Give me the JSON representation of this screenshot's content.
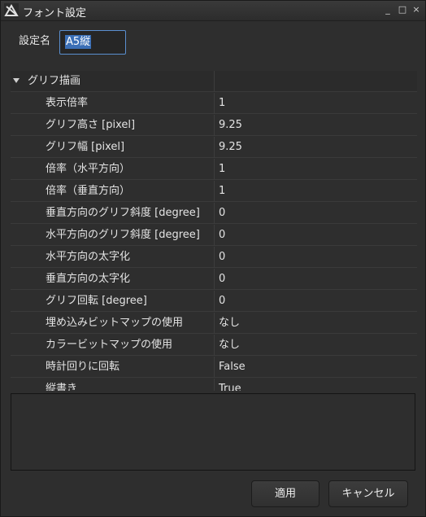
{
  "window": {
    "title": "フォント設定",
    "minimize": "_",
    "maximize": "□",
    "close": "×"
  },
  "name_field": {
    "label": "設定名",
    "value": "A5縦"
  },
  "group": {
    "label": "グリフ描画",
    "expanded": true
  },
  "properties": [
    {
      "key": "表示倍率",
      "value": "1"
    },
    {
      "key": "グリフ高さ [pixel]",
      "value": "9.25"
    },
    {
      "key": "グリフ幅 [pixel]",
      "value": "9.25"
    },
    {
      "key": "倍率（水平方向）",
      "value": "1"
    },
    {
      "key": "倍率（垂直方向）",
      "value": "1"
    },
    {
      "key": "垂直方向のグリフ斜度 [degree]",
      "value": "0"
    },
    {
      "key": "水平方向のグリフ斜度 [degree]",
      "value": "0"
    },
    {
      "key": "水平方向の太字化",
      "value": "0"
    },
    {
      "key": "垂直方向の太字化",
      "value": "0"
    },
    {
      "key": "グリフ回転 [degree]",
      "value": "0"
    },
    {
      "key": "埋め込みビットマップの使用",
      "value": "なし"
    },
    {
      "key": "カラービットマップの使用",
      "value": "なし"
    },
    {
      "key": "時計回りに回転",
      "value": "False"
    },
    {
      "key": "縦書き",
      "value": "True"
    }
  ],
  "buttons": {
    "apply": "適用",
    "cancel": "キャンセル"
  },
  "colors": {
    "background": "#2e2e2e",
    "selection": "#3b6fb6",
    "focus_border": "#5a8fd0"
  }
}
